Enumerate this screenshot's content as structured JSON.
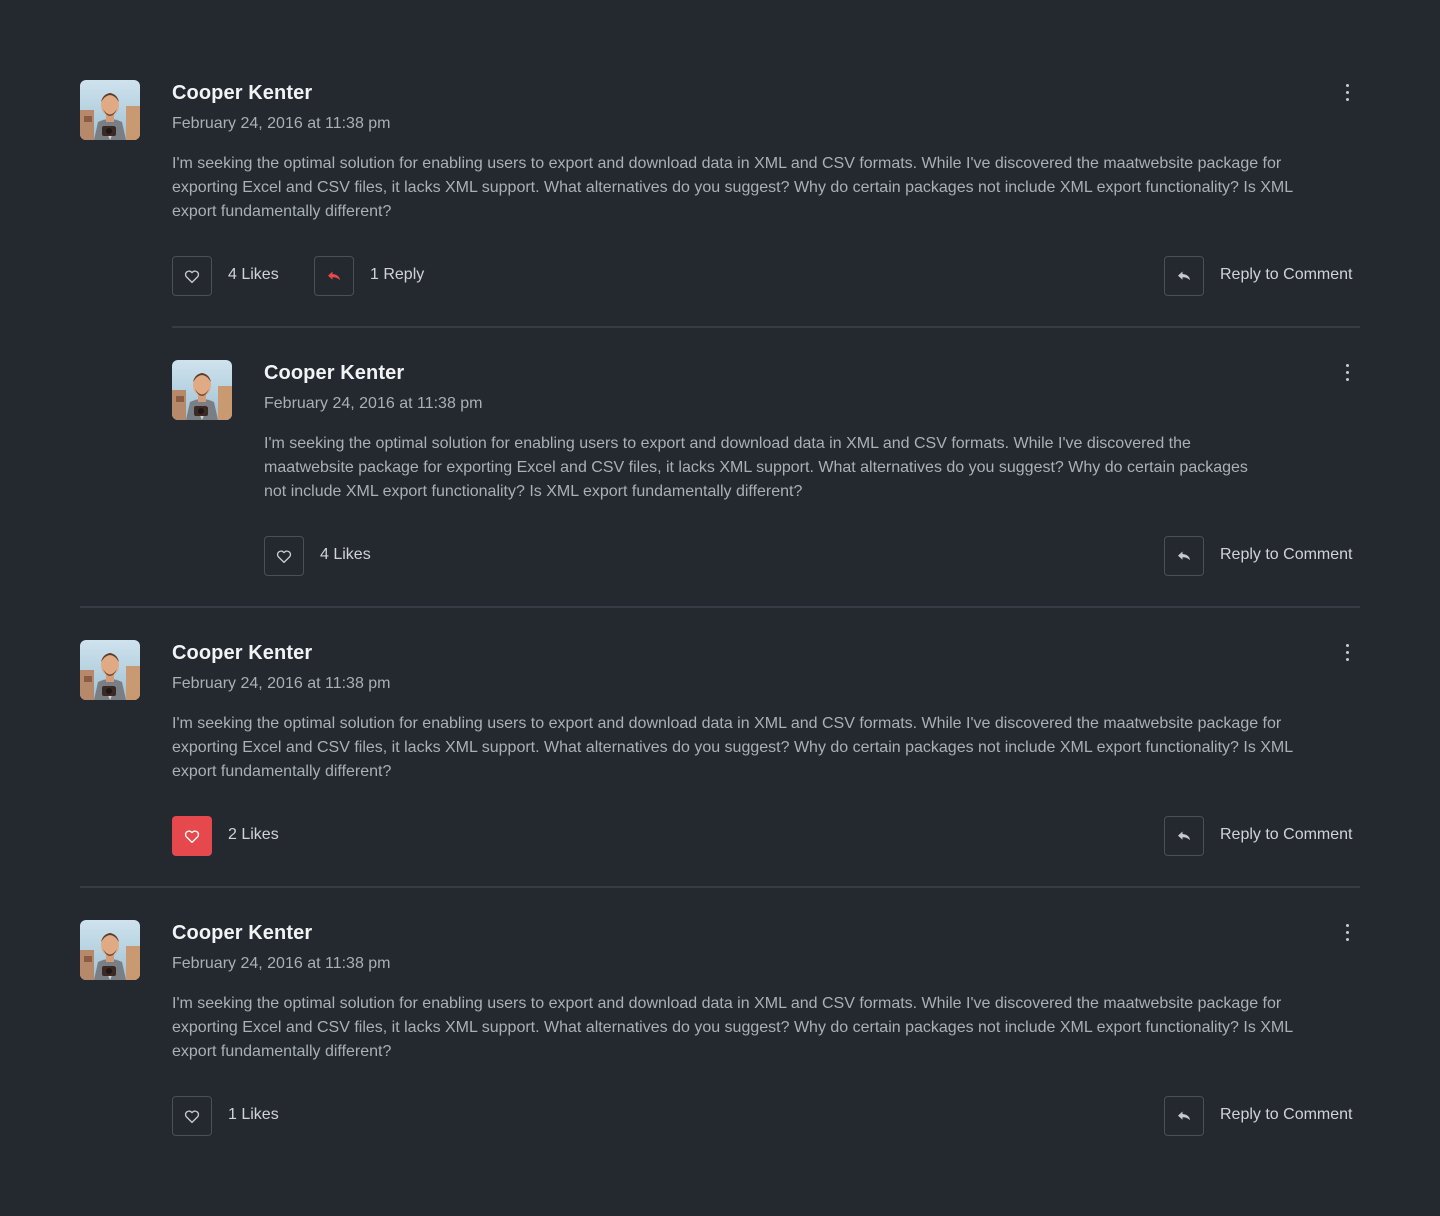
{
  "colors": {
    "background": "#24292f",
    "accent": "#e5484d",
    "divider": "#363c44",
    "text_primary": "#f1f3f5",
    "text_secondary": "#aab0b8"
  },
  "comments": [
    {
      "author": "Cooper Kenter",
      "date": "February 24, 2016 at 11:38 pm",
      "text": "I'm seeking the optimal solution for enabling users to export and download data in XML and CSV formats. While I've discovered the maatwebsite package for exporting Excel and CSV files, it lacks XML support. What alternatives do you suggest? Why do certain packages not include XML export functionality? Is XML export fundamentally different?",
      "likes_label": "4 Likes",
      "liked": false,
      "replies_label": "1 Reply",
      "reply_label": "Reply to Comment",
      "reply": {
        "author": "Cooper Kenter",
        "date": "February 24, 2016 at 11:38 pm",
        "text": "I'm seeking the optimal solution for enabling users to export and download data in XML and CSV formats. While I've discovered the maatwebsite package for exporting Excel and CSV files, it lacks XML support. What alternatives do you suggest? Why do certain packages not include XML export functionality? Is XML export fundamentally different?",
        "likes_label": "4 Likes",
        "liked": false,
        "reply_label": "Reply to Comment"
      }
    },
    {
      "author": "Cooper Kenter",
      "date": "February 24, 2016 at 11:38 pm",
      "text": "I'm seeking the optimal solution for enabling users to export and download data in XML and CSV formats. While I've discovered the maatwebsite package for exporting Excel and CSV files, it lacks XML support. What alternatives do you suggest? Why do certain packages not include XML export functionality? Is XML export fundamentally different?",
      "likes_label": "2 Likes",
      "liked": true,
      "reply_label": "Reply to Comment"
    },
    {
      "author": "Cooper Kenter",
      "date": "February 24, 2016 at 11:38 pm",
      "text": "I'm seeking the optimal solution for enabling users to export and download data in XML and CSV formats. While I've discovered the maatwebsite package for exporting Excel and CSV files, it lacks XML support. What alternatives do you suggest? Why do certain packages not include XML export functionality? Is XML export fundamentally different?",
      "likes_label": "1 Likes",
      "liked": false,
      "reply_label": "Reply to Comment"
    }
  ]
}
